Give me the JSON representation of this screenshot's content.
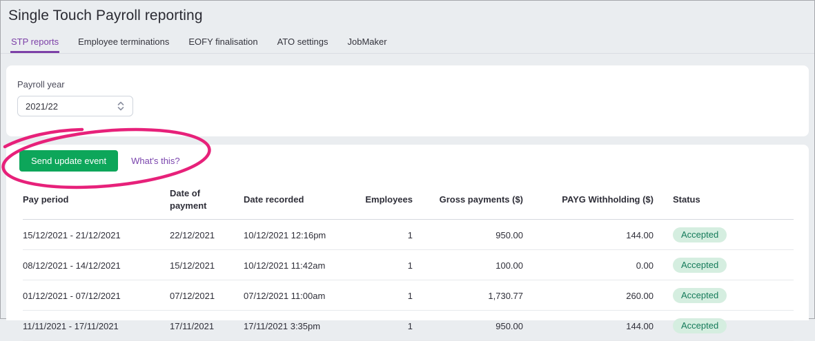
{
  "page": {
    "title": "Single Touch Payroll reporting"
  },
  "tabs": [
    "STP reports",
    "Employee terminations",
    "EOFY finalisation",
    "ATO settings",
    "JobMaker"
  ],
  "filters": {
    "payroll_year_label": "Payroll year",
    "payroll_year_value": "2021/22"
  },
  "actions": {
    "send_update_label": "Send update event",
    "whats_this_label": "What's this?"
  },
  "table": {
    "columns": [
      "Pay period",
      "Date of payment",
      "Date recorded",
      "Employees",
      "Gross payments ($)",
      "PAYG Withholding ($)",
      "Status"
    ],
    "rows": [
      {
        "pay_period": "15/12/2021 - 21/12/2021",
        "date_of_payment": "22/12/2021",
        "date_recorded": "10/12/2021 12:16pm",
        "employees": "1",
        "gross_payments": "950.00",
        "payg_withholding": "144.00",
        "status": "Accepted"
      },
      {
        "pay_period": "08/12/2021 - 14/12/2021",
        "date_of_payment": "15/12/2021",
        "date_recorded": "10/12/2021 11:42am",
        "employees": "1",
        "gross_payments": "100.00",
        "payg_withholding": "0.00",
        "status": "Accepted"
      },
      {
        "pay_period": "01/12/2021 - 07/12/2021",
        "date_of_payment": "07/12/2021",
        "date_recorded": "07/12/2021 11:00am",
        "employees": "1",
        "gross_payments": "1,730.77",
        "payg_withholding": "260.00",
        "status": "Accepted"
      },
      {
        "pay_period": "11/11/2021 - 17/11/2021",
        "date_of_payment": "17/11/2021",
        "date_recorded": "17/11/2021 3:35pm",
        "employees": "1",
        "gross_payments": "950.00",
        "payg_withholding": "144.00",
        "status": "Accepted"
      }
    ]
  },
  "colors": {
    "accent_purple": "#7c3fa7",
    "link_purple": "#7a44ad",
    "button_green": "#0da65a",
    "badge_background": "#d5eee0",
    "badge_text": "#147a59",
    "annotation_pink": "#e7217a",
    "page_background": "#eaedf0"
  }
}
